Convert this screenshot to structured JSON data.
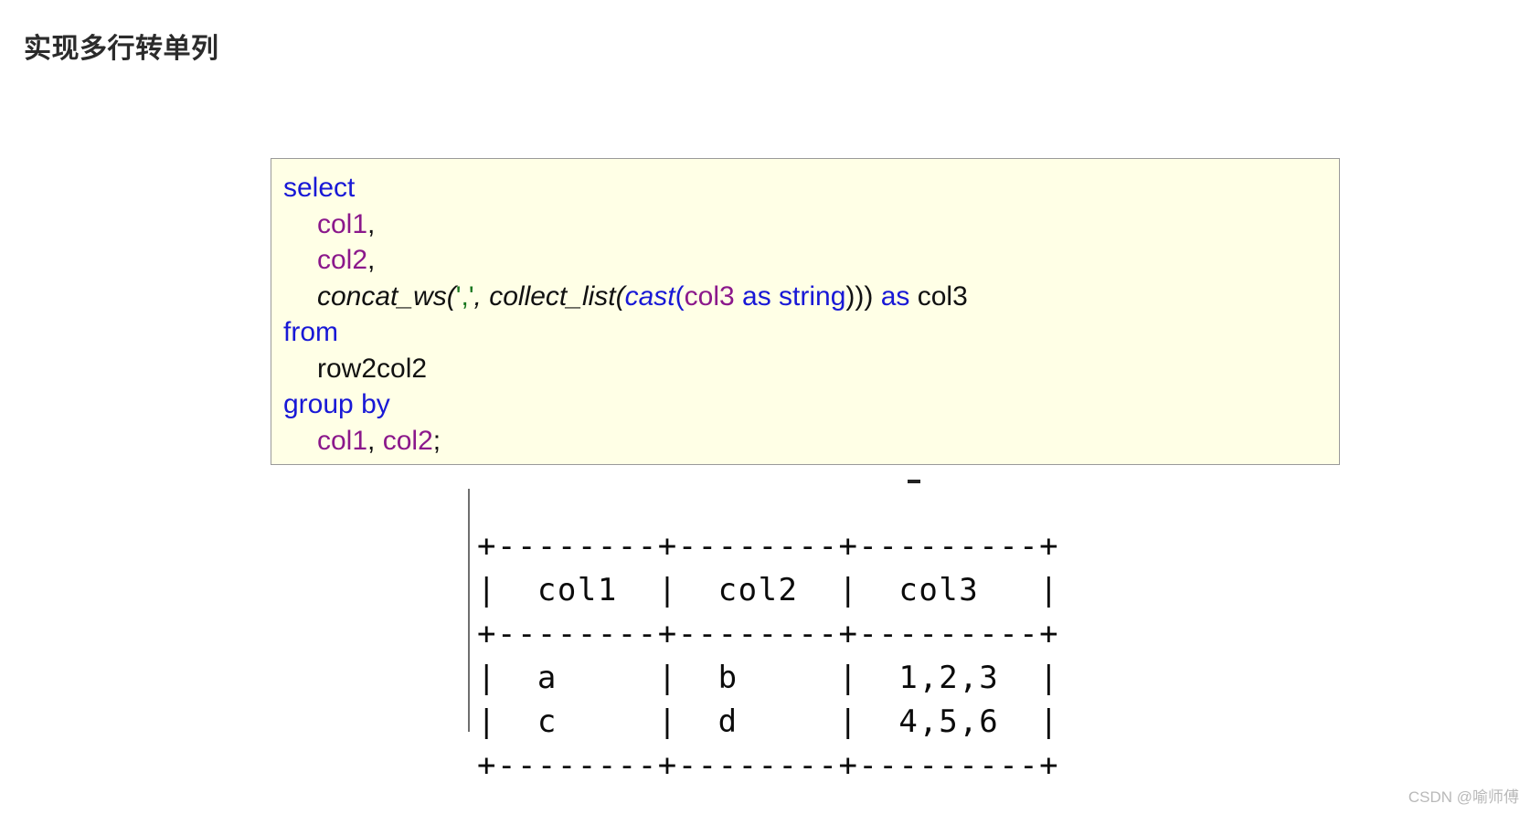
{
  "page": {
    "title": "实现多行转单列",
    "background_color": "#ffffff",
    "title_color": "#2b2b2b"
  },
  "code_block": {
    "background_color": "#ffffe6",
    "border_color": "#9a9a9a",
    "language": "sql",
    "colors": {
      "keyword": "#1818d6",
      "identifier": "#8b188b",
      "string": "#18761e",
      "plain": "#111111"
    },
    "lines": [
      {
        "tokens": [
          {
            "t": "select",
            "c": "kw"
          }
        ]
      },
      {
        "indent": 1,
        "tokens": [
          {
            "t": "col1",
            "c": "ident"
          },
          {
            "t": ",",
            "c": "plain"
          }
        ]
      },
      {
        "indent": 1,
        "tokens": [
          {
            "t": "col2",
            "c": "ident"
          },
          {
            "t": ",",
            "c": "plain"
          }
        ]
      },
      {
        "indent": 1,
        "tokens": [
          {
            "t": "concat_ws",
            "c": "fn"
          },
          {
            "t": "(",
            "c": "fn"
          },
          {
            "t": "','",
            "c": "str"
          },
          {
            "t": ", ",
            "c": "fn"
          },
          {
            "t": "collect_list",
            "c": "fn"
          },
          {
            "t": "(",
            "c": "fn"
          },
          {
            "t": "cast",
            "c": "fnkw"
          },
          {
            "t": "(",
            "c": "kw"
          },
          {
            "t": "col3",
            "c": "ident"
          },
          {
            "t": " as string",
            "c": "kw"
          },
          {
            "t": ")))",
            "c": "plain"
          },
          {
            "t": " as ",
            "c": "kw"
          },
          {
            "t": "col3",
            "c": "plain"
          }
        ]
      },
      {
        "tokens": [
          {
            "t": "from",
            "c": "kw"
          }
        ]
      },
      {
        "indent": 1,
        "tokens": [
          {
            "t": "row2col2",
            "c": "plain"
          }
        ]
      },
      {
        "tokens": [
          {
            "t": "group by",
            "c": "kw"
          }
        ]
      },
      {
        "indent": 1,
        "tokens": [
          {
            "t": "col1",
            "c": "ident"
          },
          {
            "t": ", ",
            "c": "plain"
          },
          {
            "t": "col2",
            "c": "ident"
          },
          {
            "t": ";",
            "c": "plain"
          }
        ]
      }
    ],
    "full_text": "select\n    col1,\n    col2,\n    concat_ws(',', collect_list(cast(col3 as string))) as col3\nfrom\n    row2col2\ngroup by\n    col1, col2;"
  },
  "result_table": {
    "columns": [
      "col1",
      "col2",
      "col3"
    ],
    "rows": [
      [
        "a",
        "b",
        "1,2,3"
      ],
      [
        "c",
        "d",
        "4,5,6"
      ]
    ],
    "ascii": "+--------+--------+---------+\n|  col1  |  col2  |  col3   |\n+--------+--------+---------+\n|  a     |  b     |  1,2,3  |\n|  c     |  d     |  4,5,6  |\n+--------+--------+---------+"
  },
  "watermark": {
    "text": "CSDN @喻师傅",
    "color": "#b9b9b9"
  }
}
